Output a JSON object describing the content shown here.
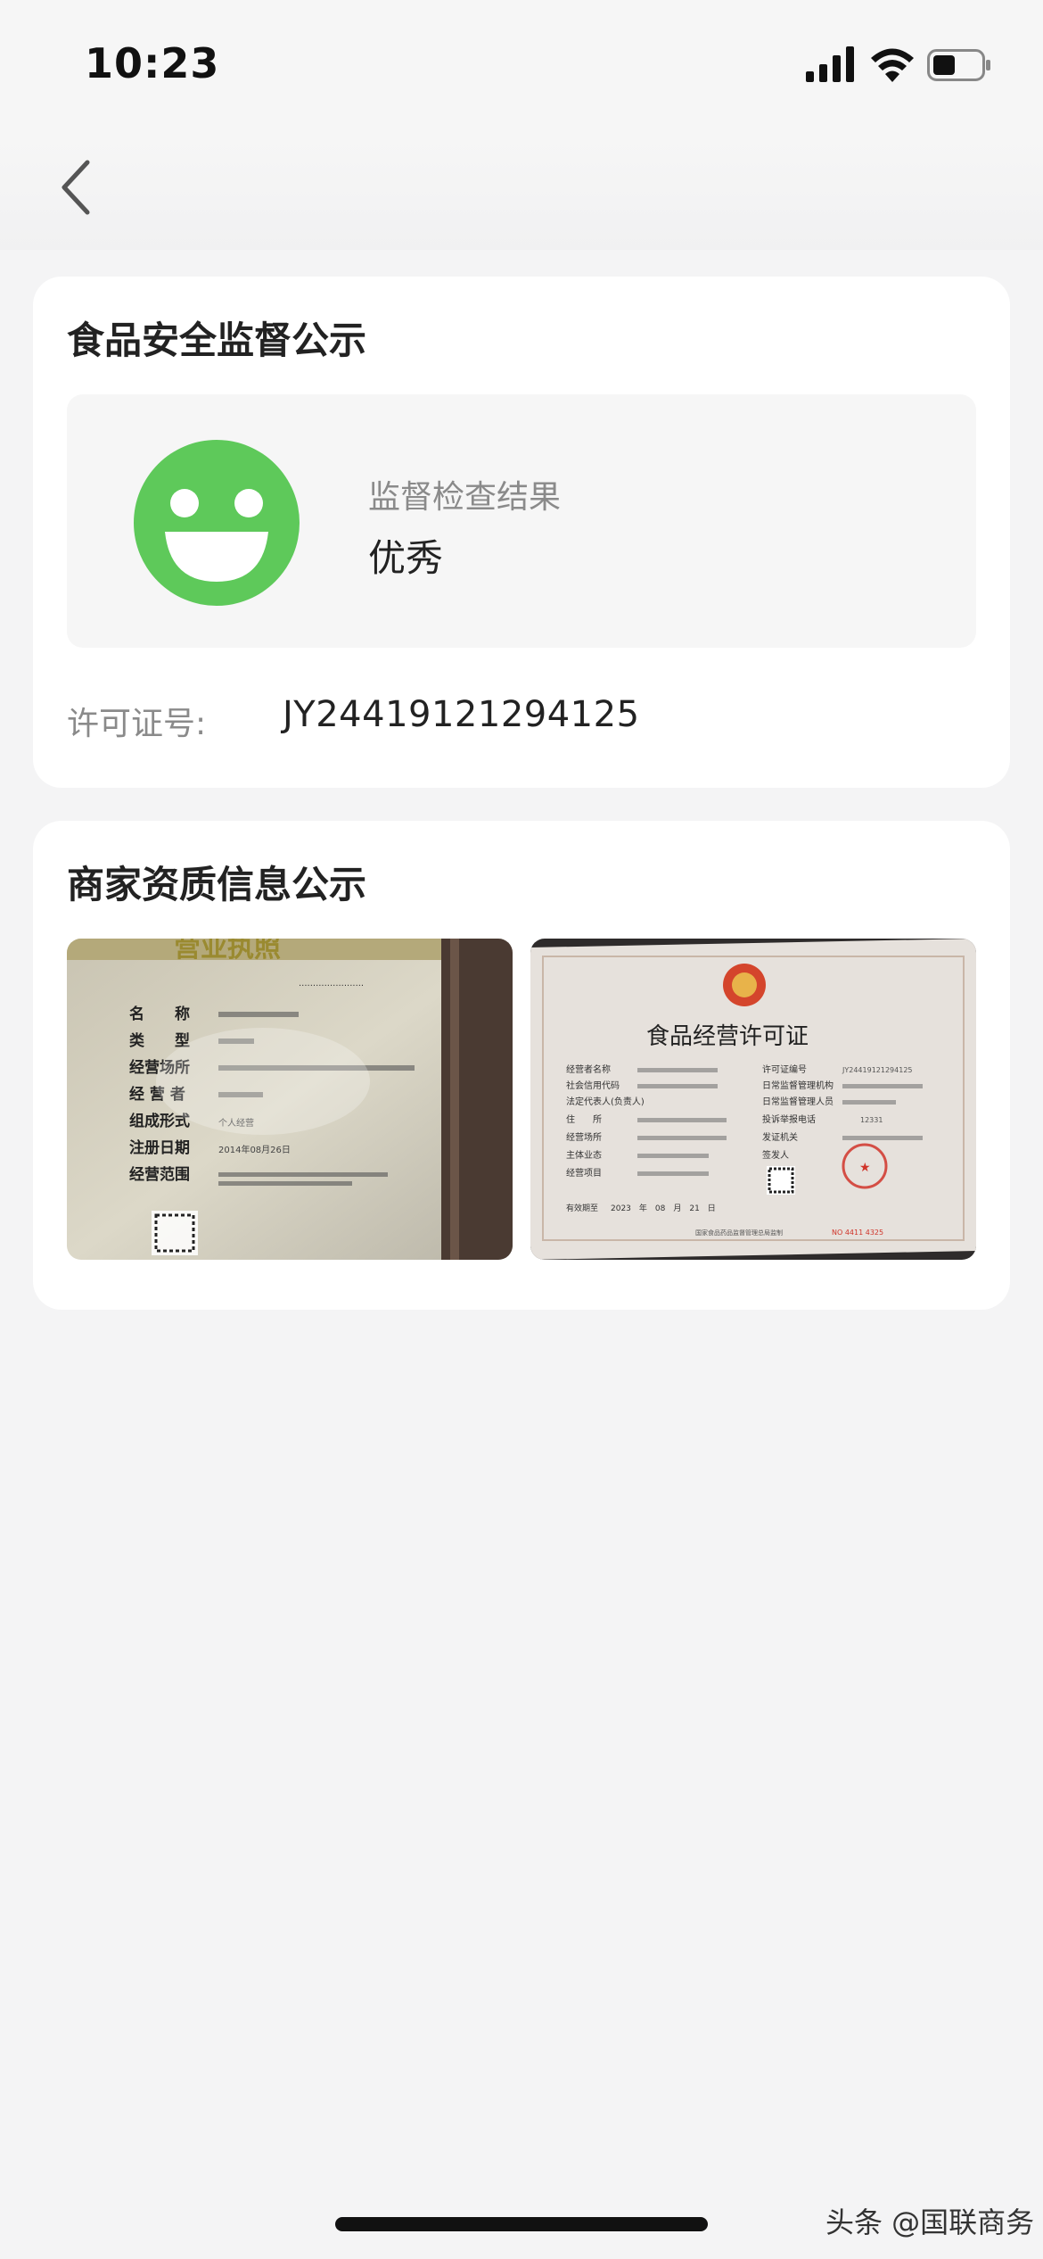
{
  "status_bar": {
    "time": "10:23"
  },
  "supervision": {
    "title": "食品安全监督公示",
    "result_label": "监督检查结果",
    "result_value": "优秀",
    "license_label": "许可证号:",
    "license_number": "JY24419121294125"
  },
  "qualification": {
    "title": "商家资质信息公示",
    "business_license": {
      "header": "营业执照",
      "field_labels": [
        "名　　称",
        "类　　型",
        "经营场所",
        "经 营 者",
        "组成形式",
        "注册日期",
        "经营范围"
      ],
      "composition": "个人经营",
      "registration_date": "2014年08月26日"
    },
    "food_license": {
      "header": "食品经营许可证",
      "left_labels": [
        "经营者名称",
        "社会信用代码",
        "法定代表人(负责人)",
        "住　　所",
        "经营场所",
        "主体业态",
        "经营项目"
      ],
      "right_labels": [
        "许可证编号",
        "日常监督管理机构",
        "日常监督管理人员",
        "投诉举报电话",
        "发证机关",
        "签发人"
      ],
      "license_number": "JY24419121294125",
      "valid_label": "有效期至",
      "valid_date": "2023　年　08　月　21　日",
      "hotline": "12331",
      "serial": "NO 4411 4325",
      "footer": "国家食品药品监督管理总局监制"
    }
  },
  "watermark": "头条 @国联商务",
  "colors": {
    "smiley": "#5ec95a",
    "card": "#ffffff",
    "background": "#f4f4f5"
  }
}
